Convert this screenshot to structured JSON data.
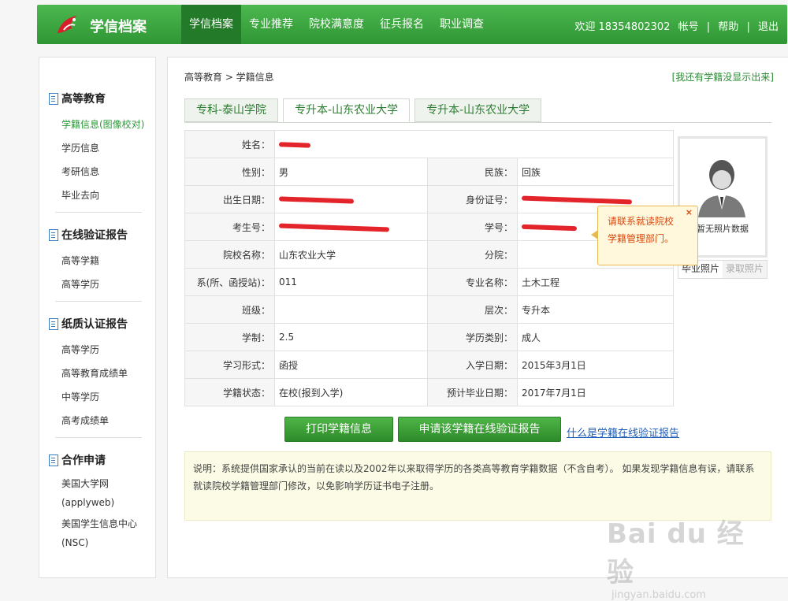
{
  "header": {
    "logo_text": "学信档案",
    "nav": [
      "学信档案",
      "专业推荐",
      "院校满意度",
      "征兵报名",
      "职业调查"
    ],
    "welcome": "欢迎 18354802302",
    "account": "帐号",
    "help": "帮助",
    "logout": "退出",
    "sep": "|"
  },
  "sidebar": {
    "groups": [
      {
        "title": "高等教育",
        "items": [
          "学籍信息(图像校对)",
          "学历信息",
          "考研信息",
          "毕业去向"
        ]
      },
      {
        "title": "在线验证报告",
        "items": [
          "高等学籍",
          "高等学历"
        ]
      },
      {
        "title": "纸质认证报告",
        "items": [
          "高等学历",
          "高等教育成绩单",
          "中等学历",
          "高考成绩单"
        ]
      },
      {
        "title": "合作申请",
        "items": [
          "美国大学网(applyweb)",
          "美国学生信息中心(NSC)"
        ]
      }
    ]
  },
  "main": {
    "breadcrumb": "高等教育 > 学籍信息",
    "feedback_link": "[我还有学籍没显示出来]",
    "tabs": [
      "专科-泰山学院",
      "专升本-山东农业大学",
      "专升本-山东农业大学"
    ],
    "info": {
      "name_label": "姓名：",
      "gender_label": "性别：",
      "gender": "男",
      "ethnic_label": "民族：",
      "ethnic": "回族",
      "birth_label": "出生日期：",
      "id_label": "身份证号：",
      "exam_no_label": "考生号：",
      "student_no_label": "学号：",
      "school_label": "院校名称：",
      "school": "山东农业大学",
      "branch_label": "分院：",
      "branch": "",
      "dept_label": "系(所、函授站)：",
      "dept": "011",
      "major_label": "专业名称：",
      "major": "土木工程",
      "class_label": "班级：",
      "class": "",
      "level_label": "层次：",
      "level": "专升本",
      "duration_label": "学制：",
      "duration": "2.5",
      "category_label": "学历类别：",
      "category": "成人",
      "form_label": "学习形式：",
      "form": "函授",
      "enroll_label": "入学日期：",
      "enroll": "2015年3月1日",
      "status_label": "学籍状态：",
      "status": "在校(报到入学)",
      "grad_label": "预计毕业日期：",
      "grad": "2017年7月1日"
    },
    "photo": {
      "caption": "暂无照片数据",
      "tab_grad": "毕业照片",
      "tab_admit": "录取照片"
    },
    "tooltip": {
      "text1": "请联系就读院校",
      "text2": "学籍管理部门。",
      "close": "×"
    },
    "buttons": {
      "print": "打印学籍信息",
      "apply": "申请该学籍在线验证报告",
      "what_link": "什么是学籍在线验证报告"
    },
    "note": {
      "line1": "说明：系统提供国家承认的当前在读以及2002年以来取得学历的各类高等教育学籍数据（不含自考）。 如果发现学籍信息有误，请联系",
      "line2": "就读院校学籍管理部门修改，以免影响学历证书电子注册。"
    }
  },
  "watermark": {
    "logo": "Bai du 经验",
    "url": "jingyan.baidu.com"
  },
  "colors": {
    "brand_green": "#3aa63e",
    "active_nav": "#237a28",
    "link_blue": "#1f5eb8",
    "warn_orange": "#d9480f",
    "redaction": "#e3242b"
  }
}
